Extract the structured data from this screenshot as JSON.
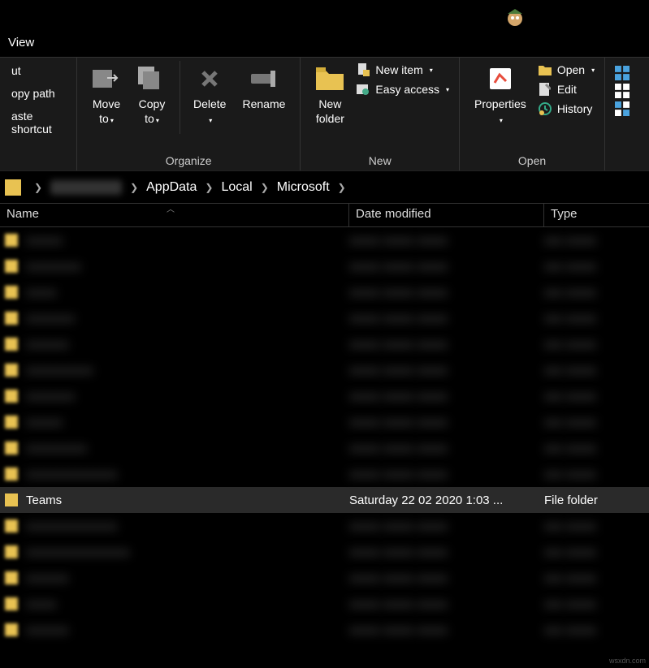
{
  "tab": {
    "view": "View"
  },
  "ribbon": {
    "clip": {
      "cut": "ut",
      "copy_path": "opy path",
      "paste_shortcut": "aste shortcut"
    },
    "organize": {
      "label": "Organize",
      "move_to": "Move\nto",
      "copy_to": "Copy\nto",
      "delete": "Delete",
      "rename": "Rename"
    },
    "new": {
      "label": "New",
      "new_folder": "New\nfolder",
      "new_item": "New item",
      "easy_access": "Easy access"
    },
    "open": {
      "label": "Open",
      "properties": "Properties",
      "open": "Open",
      "edit": "Edit",
      "history": "History"
    }
  },
  "breadcrumb": {
    "seg1": "AppData",
    "seg2": "Local",
    "seg3": "Microsoft"
  },
  "columns": {
    "name": "Name",
    "date": "Date modified",
    "type": "Type"
  },
  "rows": {
    "teams": {
      "name": "Teams",
      "date": "Saturday 22 02 2020 1:03 ...",
      "type": "File folder"
    }
  },
  "watermark": "wsxdn.com"
}
